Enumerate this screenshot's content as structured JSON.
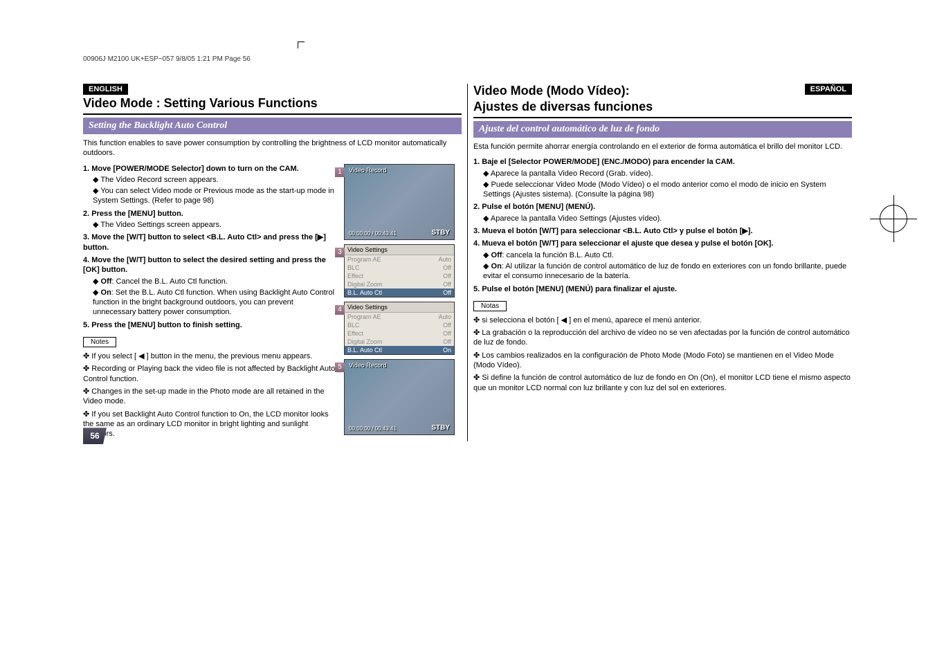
{
  "header_note": "00906J M2100 UK+ESP~057  9/8/05 1:21 PM  Page 56",
  "page_number": "56",
  "left": {
    "lang": "ENGLISH",
    "title": "Video Mode : Setting Various Functions",
    "subhead": "Setting the Backlight Auto Control",
    "intro": "This function enables to save power consumption by controlling the brightness of LCD monitor automatically outdoors.",
    "steps": [
      {
        "title": "Move [POWER/MODE Selector] down to turn on the CAM.",
        "bullets": [
          "The Video Record screen appears.",
          "You can select Video mode or Previous mode as the start-up mode in System Settings. (Refer to page 98)"
        ]
      },
      {
        "title": "Press the [MENU] button.",
        "bullets": [
          "The Video Settings screen appears."
        ]
      },
      {
        "title": "Move the [W/T] button to select <B.L. Auto Ctl> and press the [▶] button.",
        "bullets": []
      },
      {
        "title": "Move the [W/T] button to select the desired setting and press the [OK] button.",
        "bullets": [],
        "opts": [
          {
            "name": "Off",
            "desc": ": Cancel the B.L. Auto Ctl function."
          },
          {
            "name": "On",
            "desc": ": Set the B.L. Auto Ctl function. When using Backlight Auto Control function in the bright background outdoors, you can prevent unnecessary battery power consumption."
          }
        ]
      },
      {
        "title": "Press the [MENU] button to finish setting.",
        "bullets": []
      }
    ],
    "notes_label": "Notes",
    "notes": [
      "If you select [ ◀ ] button in the menu, the previous menu appears.",
      "Recording or Playing back the video file is not affected by Backlight Auto Control function.",
      "Changes in the set-up made in the Photo mode are all retained in the Video mode.",
      "If you set Backlight Auto Control function to On, the LCD monitor looks the same as an ordinary LCD monitor in bright lighting and sunlight outdoors."
    ]
  },
  "right": {
    "lang": "ESPAÑOL",
    "title_l1": "Video Mode (Modo Vídeo):",
    "title_l2": "Ajustes de diversas funciones",
    "subhead": "Ajuste del control automático de luz de fondo",
    "intro": "Esta función permite ahorrar energía controlando en el exterior de forma automática el brillo del monitor LCD.",
    "steps": [
      {
        "title": "Baje el [Selector POWER/MODE] (ENC./MODO) para encender la CAM.",
        "bullets": [
          "Aparece la pantalla Video Record (Grab. vídeo).",
          "Puede seleccionar Video Mode (Modo Vídeo) o el modo anterior como el modo de inicio en System Settings (Ajustes sistema). (Consulte la página 98)"
        ]
      },
      {
        "title": "Pulse el botón [MENU] (MENÚ).",
        "bullets": [
          "Aparece la pantalla Video Settings (Ajustes vídeo)."
        ]
      },
      {
        "title": "Mueva el botón [W/T] para seleccionar <B.L. Auto Ctl> y pulse el botón [▶].",
        "bullets": []
      },
      {
        "title": "Mueva el botón [W/T] para seleccionar el ajuste que desea y pulse el botón [OK].",
        "bullets": [],
        "opts": [
          {
            "name": "Off",
            "desc": ": cancela la función B.L. Auto Ctl."
          },
          {
            "name": "On",
            "desc": ": Al utilizar la función de control automático de luz de fondo en exteriores con un fondo brillante, puede evitar el consumo innecesario de la batería."
          }
        ]
      },
      {
        "title": "Pulse el botón [MENU] (MENÚ) para finalizar el ajuste.",
        "bullets": []
      }
    ],
    "notes_label": "Notas",
    "notes": [
      "si selecciona el botón [ ◀ ] en el menú, aparece el menú anterior.",
      "La grabación o la reproducción del archivo de vídeo no se ven afectadas por la función de control automático de luz de fondo.",
      "Los cambios realizados en la configuración de Photo Mode (Modo Foto) se mantienen en el Video Mode (Modo Vídeo).",
      "Si define la función de control automático de luz de fondo en On (On), el monitor LCD tiene el mismo aspecto que un monitor LCD normal con luz brillante y con luz del sol en exteriores."
    ]
  },
  "screens": {
    "s1": {
      "num": "1",
      "title": "Video Record",
      "time": "00:00:00 / 00:43:41",
      "stby": "STBY"
    },
    "s3": {
      "num": "3",
      "title": "Video Settings",
      "rows": [
        {
          "k": "Program AE",
          "v": "Auto"
        },
        {
          "k": "BLC",
          "v": "Off"
        },
        {
          "k": "Effect",
          "v": "Off"
        },
        {
          "k": "Digital Zoom",
          "v": "Off"
        },
        {
          "k": "B.L. Auto Ctl",
          "v": "Off",
          "active": true
        }
      ]
    },
    "s4": {
      "num": "4",
      "title": "Video Settings",
      "rows": [
        {
          "k": "Program AE",
          "v": "Auto"
        },
        {
          "k": "BLC",
          "v": "Off"
        },
        {
          "k": "Effect",
          "v": "Off"
        },
        {
          "k": "Digital Zoom",
          "v": "Off"
        },
        {
          "k": "B.L. Auto Ctl",
          "v": "On",
          "active": true
        }
      ]
    },
    "s5": {
      "num": "5",
      "title": "Video Record",
      "time": "00:00:00 / 00:43:41",
      "stby": "STBY"
    }
  }
}
